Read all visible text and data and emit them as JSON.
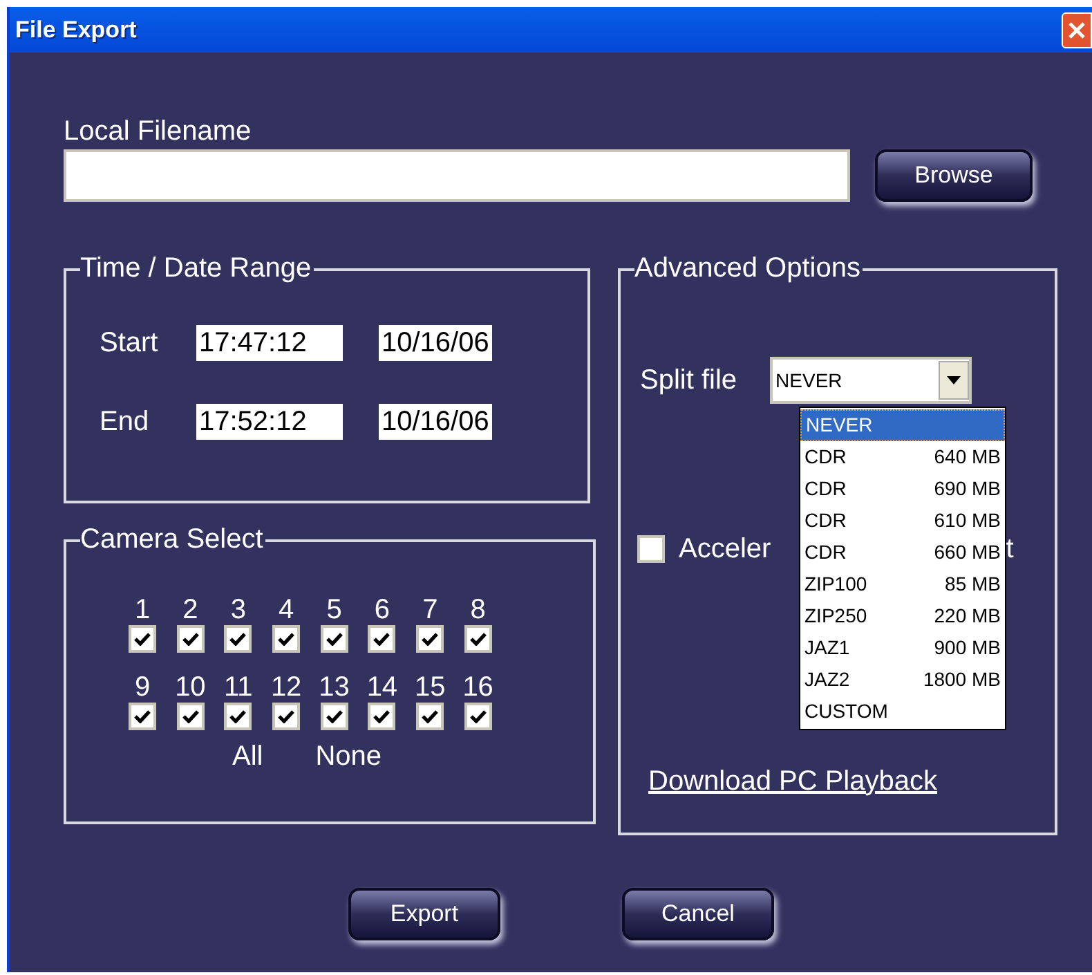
{
  "window": {
    "title": "File Export"
  },
  "filename": {
    "label": "Local Filename",
    "browse": "Browse"
  },
  "time_range": {
    "title": "Time / Date Range",
    "rows": [
      {
        "label": "Start",
        "time": "17:47:12",
        "date": "10/16/06"
      },
      {
        "label": "End",
        "time": "17:52:12",
        "date": "10/16/06"
      }
    ]
  },
  "camera_select": {
    "title": "Camera Select",
    "cameras": [
      {
        "label": "1",
        "checked": true
      },
      {
        "label": "2",
        "checked": true
      },
      {
        "label": "3",
        "checked": true
      },
      {
        "label": "4",
        "checked": true
      },
      {
        "label": "5",
        "checked": true
      },
      {
        "label": "6",
        "checked": true
      },
      {
        "label": "7",
        "checked": true
      },
      {
        "label": "8",
        "checked": true
      },
      {
        "label": "9",
        "checked": true
      },
      {
        "label": "10",
        "checked": true
      },
      {
        "label": "11",
        "checked": true
      },
      {
        "label": "12",
        "checked": true
      },
      {
        "label": "13",
        "checked": true
      },
      {
        "label": "14",
        "checked": true
      },
      {
        "label": "15",
        "checked": true
      },
      {
        "label": "16",
        "checked": true
      }
    ],
    "all": "All",
    "none": "None"
  },
  "advanced": {
    "title": "Advanced Options",
    "split_label": "Split file",
    "split_value": "NEVER",
    "split_options": [
      {
        "name": "NEVER",
        "selected": true
      },
      {
        "name": "CDR",
        "size": "640 MB",
        "selected": false
      },
      {
        "name": "CDR",
        "size": "690 MB",
        "selected": false
      },
      {
        "name": "CDR",
        "size": "610 MB",
        "selected": false
      },
      {
        "name": "CDR",
        "size": "660 MB",
        "selected": false
      },
      {
        "name": "ZIP100",
        "size": "85 MB",
        "selected": false
      },
      {
        "name": "ZIP250",
        "size": "220 MB",
        "selected": false
      },
      {
        "name": "JAZ1",
        "size": "900 MB",
        "selected": false
      },
      {
        "name": "JAZ2",
        "size": "1800 MB",
        "selected": false
      },
      {
        "name": "CUSTOM",
        "selected": false
      }
    ],
    "option": {
      "label_start": "Acceler",
      "label_end": "t",
      "checked": false
    },
    "download_link": "Download PC Playback"
  },
  "buttons": [
    "Export",
    "Cancel"
  ]
}
